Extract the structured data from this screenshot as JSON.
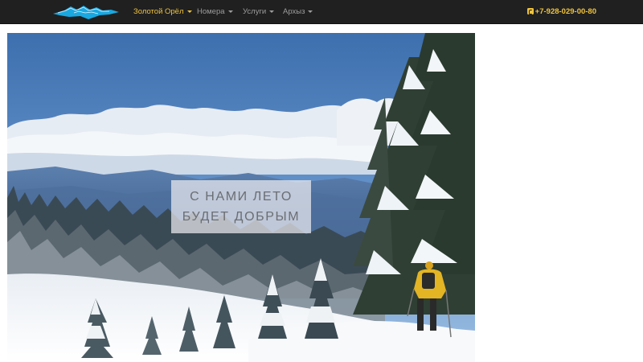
{
  "navbar": {
    "logo": {
      "icon": "mountain-logo-icon"
    },
    "items": [
      {
        "label": "Золотой Орёл",
        "active": true,
        "dropdown": true
      },
      {
        "label": "Номера",
        "active": false,
        "dropdown": true
      },
      {
        "label": "Услуги",
        "active": false,
        "dropdown": true
      },
      {
        "label": "Архыз",
        "active": false,
        "dropdown": true
      }
    ],
    "phone": {
      "icon": "phone-square-icon",
      "number": "+7-928-029-00-80"
    }
  },
  "hero": {
    "caption_line1": "С НАМИ ЛЕТО",
    "caption_line2": "БУДЕТ ДОБРЫМ"
  },
  "colors": {
    "navbar_bg": "#202020",
    "accent": "#f0c33c",
    "nav_text": "#9d9d9d"
  }
}
